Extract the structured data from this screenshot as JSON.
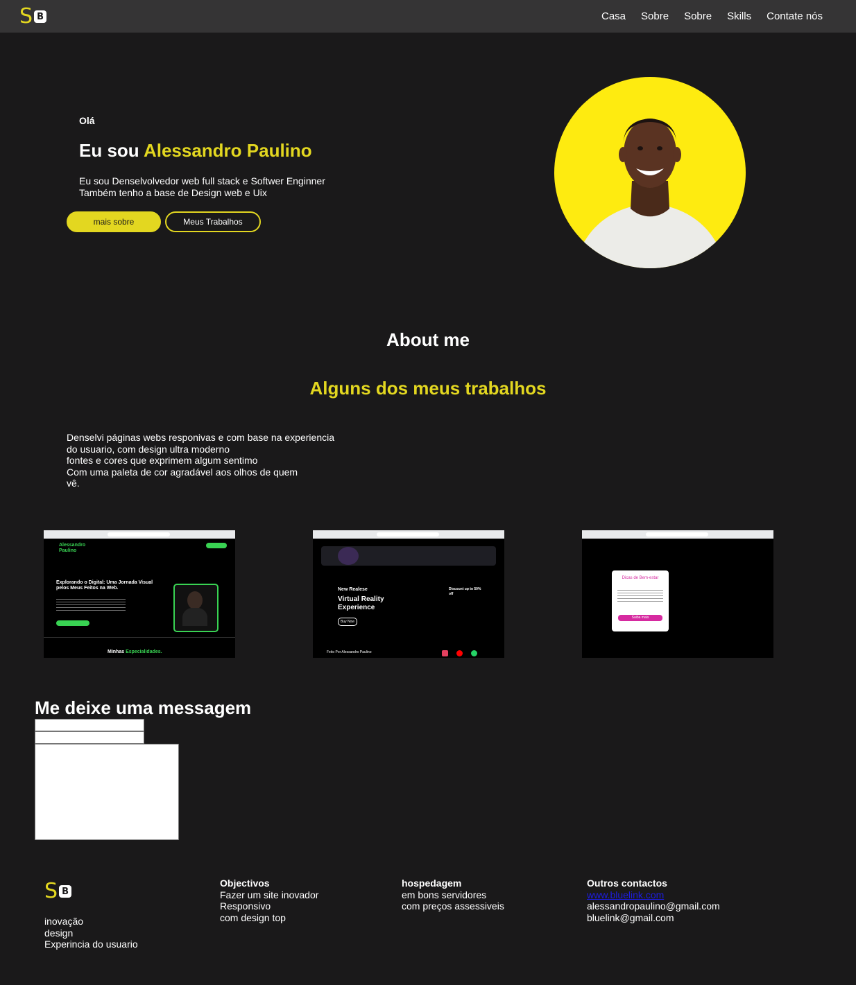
{
  "nav": {
    "logo_letter": "S",
    "logo_badge": "B",
    "links": [
      "Casa",
      "Sobre",
      "Sobre",
      "Skills",
      "Contate nós"
    ]
  },
  "hero": {
    "greeting": "Olá",
    "title_prefix": "Eu sou ",
    "title_name": "Alessandro Paulino",
    "description_line1": "Eu sou Denselvolvedor web full stack e Softwer Enginner",
    "description_line2": "Também tenho a base de Design web e Uix",
    "primary_button": "mais sobre",
    "secondary_button": "Meus Trabalhos"
  },
  "about": {
    "title": "About me",
    "works_title": "Alguns dos meus trabalhos",
    "description_lines": [
      "Denselvi páginas webs responivas e com base na experiencia",
      "do usuario, com design ultra moderno",
      "fontes e cores que exprimem algum sentimo",
      "Com uma paleta de cor agradável aos olhos de quem",
      "vê."
    ]
  },
  "works": {
    "shot1": {
      "brand": "Alessandro Paulino",
      "headline": "Explorando o Digital: Uma Jornada Visual pelos Meus Feitos na Web.",
      "footer_prefix": "Minhas ",
      "footer_highlight": "Especialidades."
    },
    "shot2": {
      "tag": "New Realese",
      "headline": "Virtual Reality Experience",
      "button": "Buy Now",
      "discount": "Discount up to 50% off",
      "credit": "Feito Por Alessandro Paulino"
    },
    "shot3": {
      "card_title": "Dicas de Bem-estar",
      "card_button": "Saiba mais"
    }
  },
  "contact": {
    "title": "Me deixe uma messagem"
  },
  "footer": {
    "col1": [
      "inovação",
      "design",
      "Experincia do usuario"
    ],
    "col2": {
      "heading": "Objectivos",
      "lines": [
        "Fazer um site inovador",
        "Responsivo",
        "com design top"
      ]
    },
    "col3": {
      "heading": "hospedagem",
      "lines": [
        "em bons servidores",
        "com preços assessiveis"
      ]
    },
    "col4": {
      "heading": "Outros contactos",
      "link": "www.bluelink.com",
      "lines": [
        "alessandropaulino@gmail.com",
        "bluelink@gmail.com"
      ]
    }
  },
  "colors": {
    "accent": "#e3d720",
    "background": "#1a191a",
    "navbar": "#353435",
    "avatar_bg": "#feeb10",
    "link": "#1d1de0"
  }
}
